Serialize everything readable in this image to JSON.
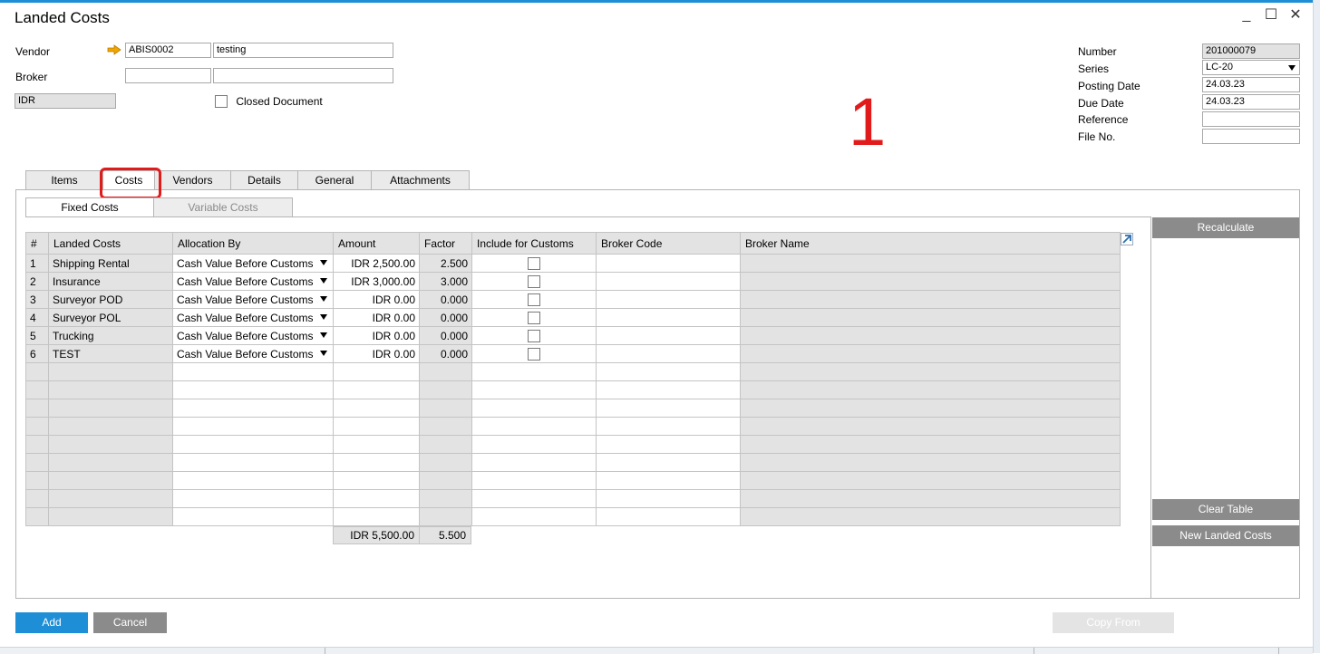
{
  "window": {
    "title": "Landed Costs",
    "minimize": "_",
    "maximize": "☐",
    "close": "✕"
  },
  "header_left": {
    "vendor_label": "Vendor",
    "vendor_code": "ABIS0002",
    "vendor_name": "testing",
    "broker_label": "Broker",
    "broker_code": "",
    "broker_name": "",
    "currency": "IDR",
    "closed_document_label": "Closed Document",
    "closed_document_checked": false
  },
  "header_right": {
    "number_label": "Number",
    "number_value": "201000079",
    "series_label": "Series",
    "series_value": "LC-20",
    "posting_date_label": "Posting Date",
    "posting_date_value": "24.03.23",
    "due_date_label": "Due Date",
    "due_date_value": "24.03.23",
    "reference_label": "Reference",
    "reference_value": "",
    "file_no_label": "File No.",
    "file_no_value": ""
  },
  "annotation": {
    "number": "1",
    "color": "#e11b1b"
  },
  "tabs": [
    {
      "label": "Items",
      "active": false
    },
    {
      "label": "Costs",
      "active": true
    },
    {
      "label": "Vendors",
      "active": false
    },
    {
      "label": "Details",
      "active": false
    },
    {
      "label": "General",
      "active": false
    },
    {
      "label": "Attachments",
      "active": false
    }
  ],
  "subtabs": [
    {
      "label": "Fixed Costs",
      "active": true
    },
    {
      "label": "Variable Costs",
      "active": false
    }
  ],
  "grid": {
    "columns": [
      "#",
      "Landed Costs",
      "Allocation By",
      "Amount",
      "Factor",
      "Include for Customs",
      "Broker Code",
      "Broker Name"
    ],
    "rows": [
      {
        "num": "1",
        "name": "Shipping Rental",
        "allocation": "Cash Value Before Customs",
        "amount": "IDR 2,500.00",
        "factor": "2.500",
        "include": false,
        "broker_code": "",
        "broker_name": ""
      },
      {
        "num": "2",
        "name": "Insurance",
        "allocation": "Cash Value Before Customs",
        "amount": "IDR 3,000.00",
        "factor": "3.000",
        "include": false,
        "broker_code": "",
        "broker_name": ""
      },
      {
        "num": "3",
        "name": "Surveyor POD",
        "allocation": "Cash Value Before Customs",
        "amount": "IDR 0.00",
        "factor": "0.000",
        "include": false,
        "broker_code": "",
        "broker_name": ""
      },
      {
        "num": "4",
        "name": "Surveyor POL",
        "allocation": "Cash Value Before Customs",
        "amount": "IDR 0.00",
        "factor": "0.000",
        "include": false,
        "broker_code": "",
        "broker_name": ""
      },
      {
        "num": "5",
        "name": "Trucking",
        "allocation": "Cash Value Before Customs",
        "amount": "IDR 0.00",
        "factor": "0.000",
        "include": false,
        "broker_code": "",
        "broker_name": ""
      },
      {
        "num": "6",
        "name": "TEST",
        "allocation": "Cash Value Before Customs",
        "amount": "IDR 0.00",
        "factor": "0.000",
        "include": false,
        "broker_code": "",
        "broker_name": ""
      }
    ],
    "total_amount": "IDR 5,500.00",
    "total_factor": "5.500"
  },
  "side_buttons": {
    "recalculate": "Recalculate",
    "clear_table": "Clear Table",
    "new_landed_costs": "New Landed Costs"
  },
  "footer": {
    "add": "Add",
    "cancel": "Cancel",
    "copy_from": "Copy From"
  },
  "colors": {
    "accent": "#1e8fd6",
    "button_gray": "#8b8b8b",
    "highlight": "#e11b1b"
  }
}
